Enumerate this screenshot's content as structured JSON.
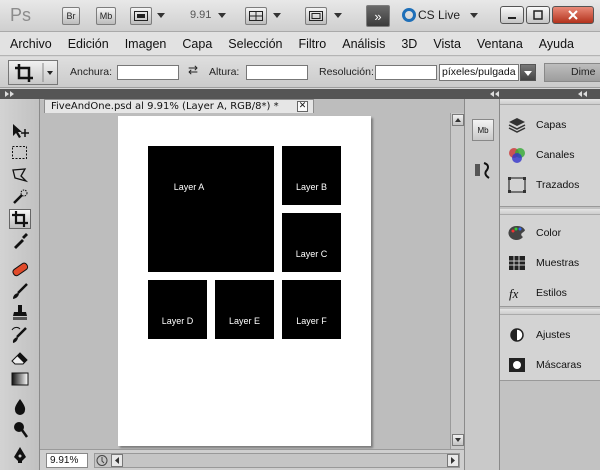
{
  "titlebar": {
    "app_logo": "Ps",
    "bridge_label": "Br",
    "minibridge_label": "Mb",
    "zoom_value": "9.91",
    "cslive_label": "CS Live"
  },
  "menu": [
    "Archivo",
    "Edición",
    "Imagen",
    "Capa",
    "Selección",
    "Filtro",
    "Análisis",
    "3D",
    "Vista",
    "Ventana",
    "Ayuda"
  ],
  "options": {
    "width_label": "Anchura:",
    "width_value": "",
    "height_label": "Altura:",
    "height_value": "",
    "resolution_label": "Resolución:",
    "resolution_value": "",
    "units_value": "píxeles/pulgada",
    "dime_label": "Dime"
  },
  "document": {
    "tab_title": "FiveAndOne.psd al 9.91% (Layer A, RGB/8*) *",
    "close_glyph": "✕",
    "layers": [
      {
        "name": "Layer A"
      },
      {
        "name": "Layer B"
      },
      {
        "name": "Layer C"
      },
      {
        "name": "Layer D"
      },
      {
        "name": "Layer E"
      },
      {
        "name": "Layer F"
      }
    ]
  },
  "status": {
    "zoom": "9.91%"
  },
  "panels": {
    "group1": [
      {
        "label": "Capas",
        "icon": "layers-icon"
      },
      {
        "label": "Canales",
        "icon": "channels-icon"
      },
      {
        "label": "Trazados",
        "icon": "paths-icon"
      }
    ],
    "group2": [
      {
        "label": "Color",
        "icon": "color-icon"
      },
      {
        "label": "Muestras",
        "icon": "swatches-icon"
      },
      {
        "label": "Estilos",
        "icon": "styles-icon"
      }
    ],
    "group3": [
      {
        "label": "Ajustes",
        "icon": "adjustments-icon"
      },
      {
        "label": "Máscaras",
        "icon": "masks-icon"
      }
    ]
  },
  "colors": {
    "accent_blue": "#1e6fb8",
    "panel_gray": "#d3d3d3",
    "canvas_gray": "#bdbdbd"
  }
}
